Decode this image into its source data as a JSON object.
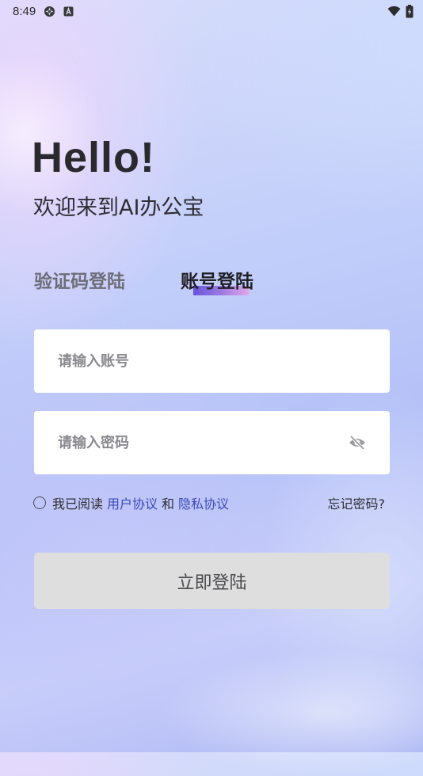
{
  "status_bar": {
    "time": "8:49",
    "left_icons": [
      "app-circle-icon",
      "app-a-icon"
    ],
    "right_icons": [
      "wifi-icon",
      "battery-icon"
    ]
  },
  "header": {
    "greeting": "Hello!",
    "welcome": "欢迎来到AI办公宝"
  },
  "tabs": [
    {
      "label": "验证码登陆",
      "active": false
    },
    {
      "label": "账号登陆",
      "active": true
    }
  ],
  "form": {
    "account": {
      "placeholder": "请输入账号",
      "value": ""
    },
    "password": {
      "placeholder": "请输入密码",
      "value": "",
      "toggle_icon": "eye-off-icon"
    }
  },
  "agreement": {
    "checked": false,
    "prefix": "我已阅读",
    "user_agreement": "用户协议",
    "and": "和",
    "privacy_agreement": "隐私协议"
  },
  "forgot_password": "忘记密码?",
  "login_button": "立即登陆",
  "colors": {
    "link": "#3e49b8",
    "tab_indicator": "#7b5ce0",
    "button_bg": "#dedede"
  }
}
